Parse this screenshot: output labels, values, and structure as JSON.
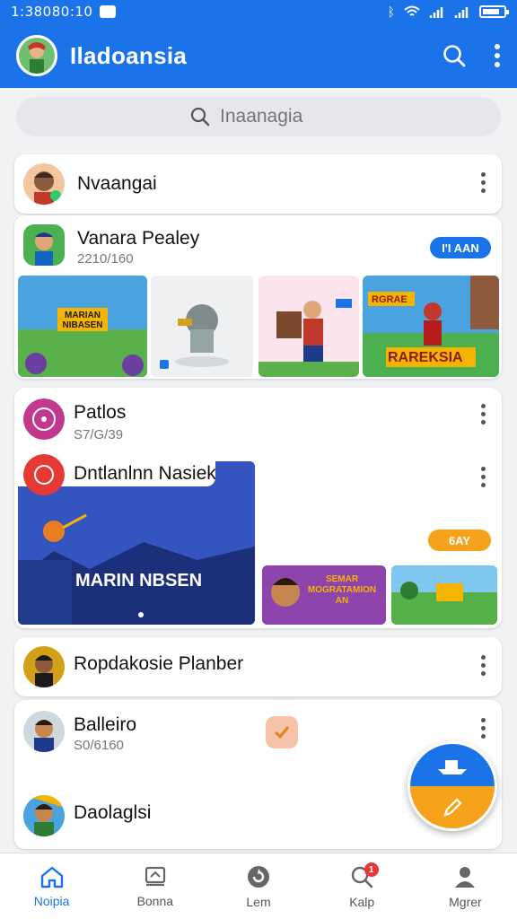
{
  "status_bar": {
    "time": "1:38080:10"
  },
  "app_bar": {
    "title": "Iladoansia"
  },
  "search": {
    "placeholder": "Inaanagia"
  },
  "cards": [
    {
      "title": "Nvaangai"
    },
    {
      "title": "Vanara Pealey",
      "subtitle": "2210/160",
      "pill": "I'I AAN",
      "thumb_caption_1": "MARIAN\nNIBASEN",
      "thumb_caption_4": "RAREKSIA",
      "thumb_tag_4": "RGRAE"
    },
    {
      "title": "Patlos",
      "subtitle": "S7/G/39"
    },
    {
      "title": "Dntlanlnn Nasiek",
      "pill": "6AY",
      "banner_text": "MARIN NBSEN",
      "thumb_caption_2": "SEMAR\nMOGRATAMION\nAN"
    },
    {
      "title": "Ropdakosie Planber"
    },
    {
      "title": "Balleiro",
      "subtitle": "S0/6160"
    },
    {
      "title": "Daolaglsi"
    }
  ],
  "bottom_nav": [
    {
      "label": "Noipia",
      "icon": "home-icon",
      "active": true
    },
    {
      "label": "Bonna",
      "icon": "inbox-icon",
      "active": false
    },
    {
      "label": "Lem",
      "icon": "refresh-icon",
      "active": false
    },
    {
      "label": "Kalp",
      "icon": "search-alert-icon",
      "active": false,
      "badge": "1"
    },
    {
      "label": "Mgrer",
      "icon": "profile-icon",
      "active": false
    }
  ],
  "colors": {
    "primary": "#1a73e8",
    "accent": "#f7a21b",
    "badge": "#e53935"
  }
}
